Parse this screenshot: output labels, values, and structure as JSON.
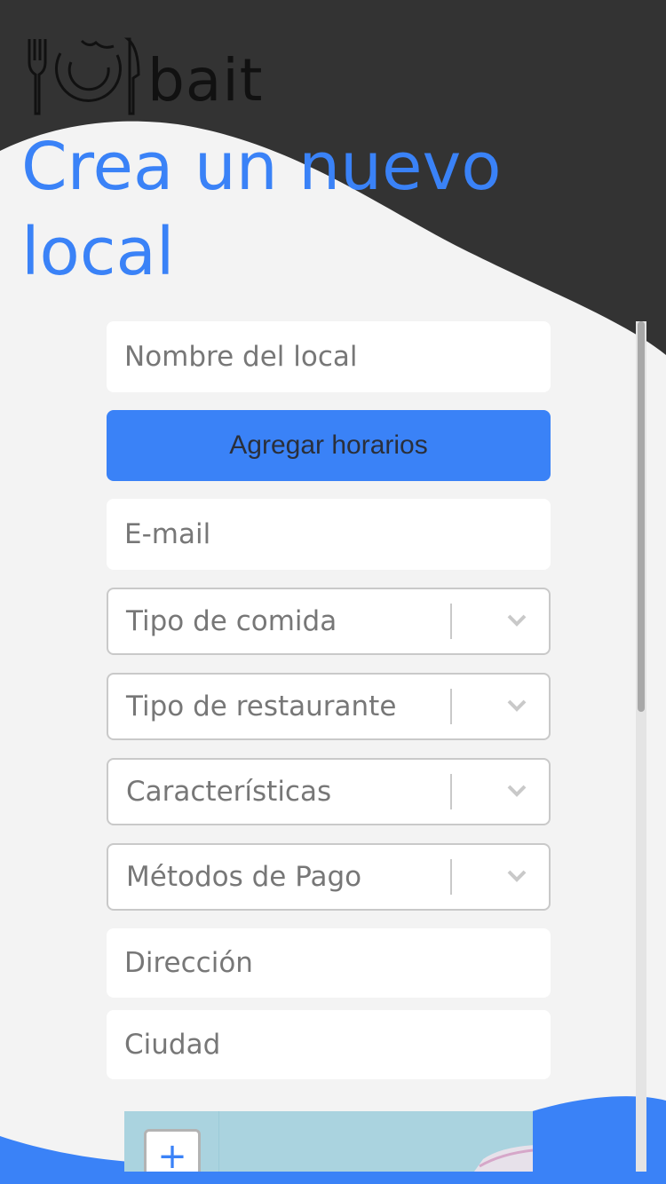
{
  "brand": {
    "name": "bait"
  },
  "page": {
    "title": "Crea un nuevo local"
  },
  "form": {
    "name_placeholder": "Nombre del local",
    "add_hours_label": "Agregar horarios",
    "email_placeholder": "E-mail",
    "food_type": {
      "placeholder": "Tipo de comida"
    },
    "restaurant_type": {
      "placeholder": "Tipo de restaurante"
    },
    "features": {
      "placeholder": "Características"
    },
    "payment_methods": {
      "placeholder": "Métodos de Pago"
    },
    "address_placeholder": "Dirección",
    "city_placeholder": "Ciudad"
  },
  "map": {
    "zoom_in_label": "+"
  },
  "icons": {
    "logo": "plate-fork-knife-icon",
    "dropdown": "chevron-down-icon"
  },
  "colors": {
    "accent": "#3a82f7",
    "header_dark": "#333333",
    "background": "#f3f3f3"
  }
}
